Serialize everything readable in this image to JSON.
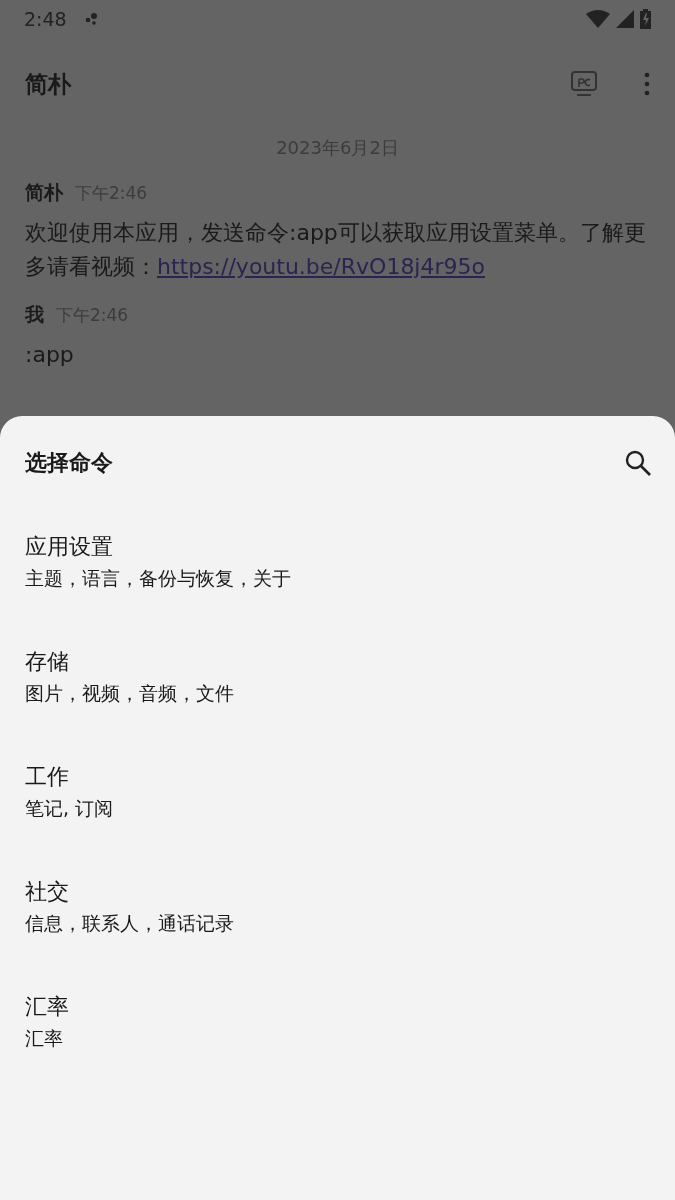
{
  "status_bar": {
    "time": "2:48"
  },
  "app_bar": {
    "title": "简朴"
  },
  "chat": {
    "date": "2023年6月2日",
    "messages": [
      {
        "sender": "简朴",
        "time": "下午2:46",
        "text": "欢迎使用本应用，发送命令:app可以获取应用设置菜单。了解更多请看视频：",
        "link": "https://youtu.be/RvO18j4r95o"
      },
      {
        "sender": "我",
        "time": "下午2:46",
        "text": ":app"
      }
    ]
  },
  "sheet": {
    "title": "选择命令",
    "items": [
      {
        "title": "应用设置",
        "subtitle": "主题，语言，备份与恢复，关于"
      },
      {
        "title": "存储",
        "subtitle": "图片，视频，音频，文件"
      },
      {
        "title": "工作",
        "subtitle": "笔记, 订阅"
      },
      {
        "title": "社交",
        "subtitle": "信息，联系人，通话记录"
      },
      {
        "title": "汇率",
        "subtitle": "汇率"
      }
    ]
  }
}
